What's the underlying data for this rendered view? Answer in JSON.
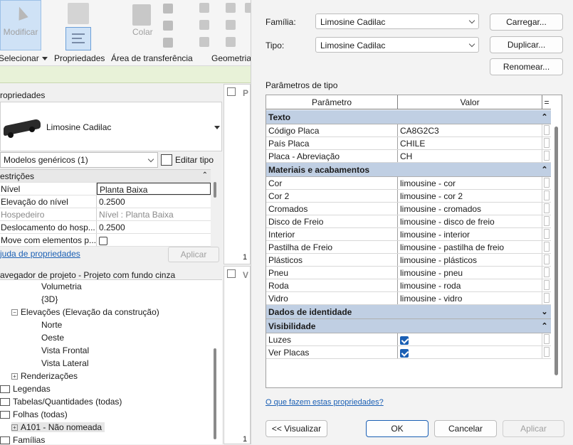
{
  "ribbon": {
    "modificar_label": "Modificar",
    "selecionar_label": "Selecionar",
    "propriedades_label": "Propriedades",
    "area_transferencia_label": "Área de transferência",
    "colar_label": "Colar",
    "geometria_label": "Geometria"
  },
  "properties_panel": {
    "title": "ropriedades",
    "family_name": "Limosine Cadilac",
    "category_combo": "Modelos genéricos (1)",
    "edit_type_label": "Editar tipo",
    "restricoes_label": "estrições",
    "rows": [
      {
        "key": "Nível",
        "value": "Planta Baixa"
      },
      {
        "key": "Elevação do nível",
        "value": "0.2500"
      },
      {
        "key": "Hospedeiro",
        "value": "Nível : Planta Baixa"
      },
      {
        "key": "Deslocamento do hosp...",
        "value": "0.2500"
      },
      {
        "key": "Move com elementos p...",
        "value": ""
      }
    ],
    "help_link": "juda de propriedades",
    "apply_label": "Aplicar"
  },
  "views": {
    "tab1_letter": "P",
    "tab1_num": "1",
    "tab2_letter": "V",
    "tab2_num": "1"
  },
  "browser": {
    "title": "avegador de projeto - Projeto com fundo cinza",
    "items": [
      {
        "label": "Volumetria"
      },
      {
        "label": "{3D}"
      },
      {
        "label": "Elevações (Elevação da construção)"
      },
      {
        "label": "Norte"
      },
      {
        "label": "Oeste"
      },
      {
        "label": "Vista Frontal"
      },
      {
        "label": "Vista Lateral"
      },
      {
        "label": "Renderizações"
      },
      {
        "label": "Legendas"
      },
      {
        "label": "Tabelas/Quantidades (todas)"
      },
      {
        "label": "Folhas (todas)"
      },
      {
        "label": "A101 - Não nomeada"
      },
      {
        "label": "Famílias"
      }
    ]
  },
  "dialog": {
    "familia_label": "Família:",
    "familia_value": "Limosine Cadilac",
    "tipo_label": "Tipo:",
    "tipo_value": "Limosine Cadilac",
    "carregar_label": "Carregar...",
    "duplicar_label": "Duplicar...",
    "renomear_label": "Renomear...",
    "parametros_label": "Parâmetros de tipo",
    "col_parametro": "Parâmetro",
    "col_valor": "Valor",
    "col_eq": "=",
    "categories": [
      {
        "name": "Texto",
        "arrow": "⌃",
        "rows": [
          {
            "p": "Código Placa",
            "v": "CA8G2C3"
          },
          {
            "p": "País Placa",
            "v": "CHILE"
          },
          {
            "p": "Placa - Abreviação",
            "v": "CH"
          }
        ]
      },
      {
        "name": "Materiais e acabamentos",
        "arrow": "⌃",
        "rows": [
          {
            "p": "Cor",
            "v": "limousine - cor"
          },
          {
            "p": "Cor 2",
            "v": "limousine - cor 2"
          },
          {
            "p": "Cromados",
            "v": "limousine - cromados"
          },
          {
            "p": "Disco de Freio",
            "v": "limousine - disco de freio"
          },
          {
            "p": "Interior",
            "v": "limousine - interior"
          },
          {
            "p": "Pastilha de Freio",
            "v": "limousine - pastilha de freio"
          },
          {
            "p": "Plásticos",
            "v": "limousine - plásticos"
          },
          {
            "p": "Pneu",
            "v": "limousine - pneu"
          },
          {
            "p": "Roda",
            "v": "limousine - roda"
          },
          {
            "p": "Vidro",
            "v": "limousine - vidro"
          }
        ]
      },
      {
        "name": "Dados de identidade",
        "arrow": "⌄",
        "rows": []
      },
      {
        "name": "Visibilidade",
        "arrow": "⌃",
        "rows": [
          {
            "p": "Luzes",
            "v": "",
            "checked": true
          },
          {
            "p": "Ver Placas",
            "v": "",
            "checked": true
          }
        ]
      }
    ],
    "help_link": "O que fazem estas propriedades?",
    "visualizar_label": "<< Visualizar",
    "ok_label": "OK",
    "cancelar_label": "Cancelar",
    "aplicar_label": "Aplicar"
  },
  "colors": {
    "category_bg": "#c0cfe3",
    "accent": "#1a5fb4",
    "ribbon_green": "#e8f2d8"
  }
}
